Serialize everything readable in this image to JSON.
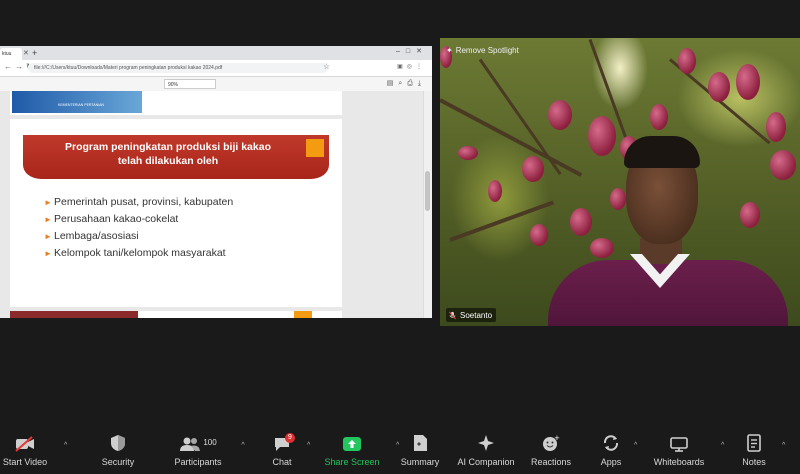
{
  "browser": {
    "tab_label": "ktuu",
    "url": "file:///C:/Users/ktuu/Downloads/Materi program peningkatan produksi kakao 2024.pdf",
    "zoom": "90%"
  },
  "slide_prev": {
    "caption": "KEMENTERIAN PERTANIAN"
  },
  "slide": {
    "title": "Program peningkatan produksi biji kakao\ntelah dilakukan oleh",
    "bullets": [
      "Pemerintah pusat, provinsi, kabupaten",
      "Perusahaan kakao-cokelat",
      "Lembaga/asosiasi",
      "Kelompok tani/kelompok masyarakat"
    ]
  },
  "video": {
    "spotlight_label": "Remove Spotlight",
    "participant_name": "Soetanto"
  },
  "toolbar": {
    "start_video": "Start Video",
    "security": "Security",
    "participants": "Participants",
    "participants_count": "100",
    "chat": "Chat",
    "chat_badge": "9",
    "share_screen": "Share Screen",
    "summary": "Summary",
    "ai_companion": "AI Companion",
    "reactions": "Reactions",
    "apps": "Apps",
    "whiteboards": "Whiteboards",
    "notes": "Notes"
  },
  "colors": {
    "share_green": "#22c55e",
    "banner_red": "#b8311f",
    "accent_orange": "#f39c12",
    "badge_red": "#e02f2f"
  }
}
